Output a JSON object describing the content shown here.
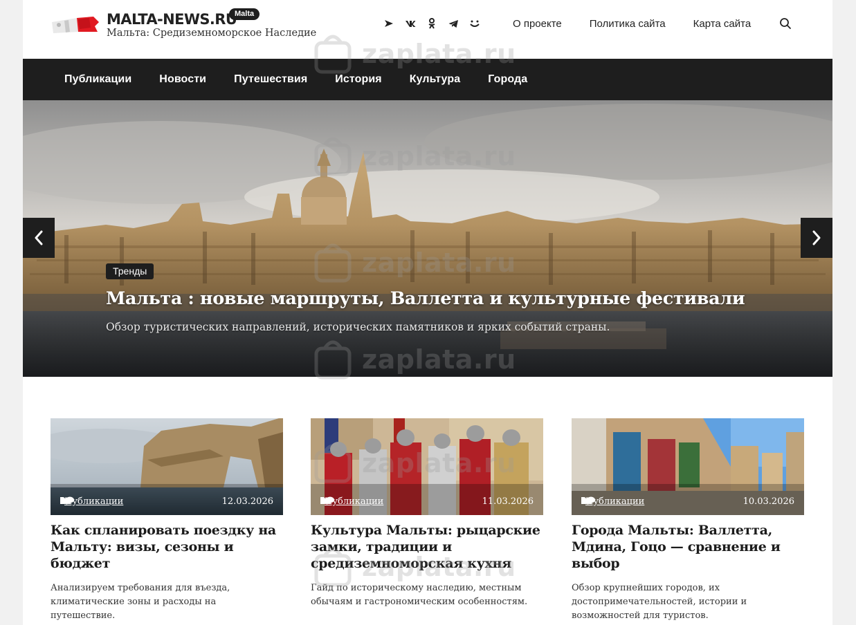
{
  "header": {
    "site_name": "MALTA-NEWS.RU",
    "badge": "Malta",
    "description": "Мальта: Средиземноморское Наследие",
    "socials": [
      "share-icon",
      "vk-icon",
      "odnoklassniki-icon",
      "telegram-icon",
      "smile-icon"
    ],
    "links": [
      "О проекте",
      "Политика сайта",
      "Карта сайта"
    ]
  },
  "nav": {
    "items": [
      "Публикации",
      "Новости",
      "Путешествия",
      "История",
      "Культура",
      "Города"
    ]
  },
  "hero": {
    "tag": "Тренды",
    "title": "Мальта : новые маршруты, Валлетта и культурные фестивали",
    "subtitle": "Обзор туристических направлений, исторических памятников и ярких событий страны."
  },
  "cards": [
    {
      "category": "Публикации",
      "date": "12.03.2026",
      "title": "Как спланировать поездку на Мальту: визы, сезоны и бюджет",
      "desc": "Анализируем требования для въезда, климатические зоны и расходы на путешествие."
    },
    {
      "category": "Публикации",
      "date": "11.03.2026",
      "title": "Культура Мальты: рыцарские замки, традиции и средиземноморская кухня",
      "desc": "Гайд по историческому наследию, местным обычаям и гастрономическим особенностям."
    },
    {
      "category": "Публикации",
      "date": "10.03.2026",
      "title": "Города Мальты: Валлетта, Мдина, Гоцо — сравнение и выбор",
      "desc": "Обзор крупнейших городов, их достопримечательностей, истории и возможностей для туристов."
    }
  ],
  "watermark": "zaplata.ru"
}
